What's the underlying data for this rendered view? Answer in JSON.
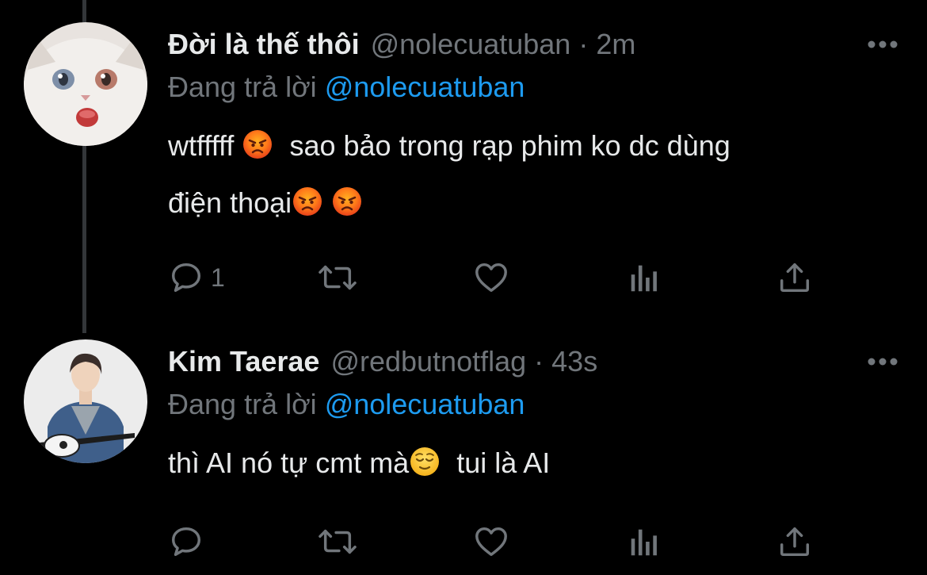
{
  "colors": {
    "background": "#000000",
    "text_primary": "#e7e9ea",
    "text_secondary": "#71767b",
    "mention": "#1d9bf0",
    "thread_line": "#333639"
  },
  "tweets": [
    {
      "display_name": "Đời là thế thôi",
      "handle": "@nolecuatuban",
      "dot": "·",
      "time": "2m",
      "reply_prefix": "Đang trả lời",
      "reply_to": "@nolecuatuban",
      "text_part1": "wtfffff",
      "text_part2": "sao bảo trong rạp phim ko dc dùng",
      "text_part3": "điện thoại",
      "emojis": [
        "angry-face",
        "angry-face",
        "angry-face"
      ],
      "reply_count": "1",
      "avatar": "white-cat-avatar"
    },
    {
      "display_name": "Kim Taerae",
      "handle": "@redbutnotflag",
      "dot": "·",
      "time": "43s",
      "reply_prefix": "Đang trả lời",
      "reply_to": "@nolecuatuban",
      "text_part1": "thì AI nó tự cmt mà",
      "text_part2": "tui là AI",
      "emojis": [
        "relieved-face"
      ],
      "reply_count": "",
      "avatar": "man-with-guitar-avatar"
    }
  ],
  "actions": [
    "reply",
    "retweet",
    "like",
    "views",
    "share"
  ]
}
